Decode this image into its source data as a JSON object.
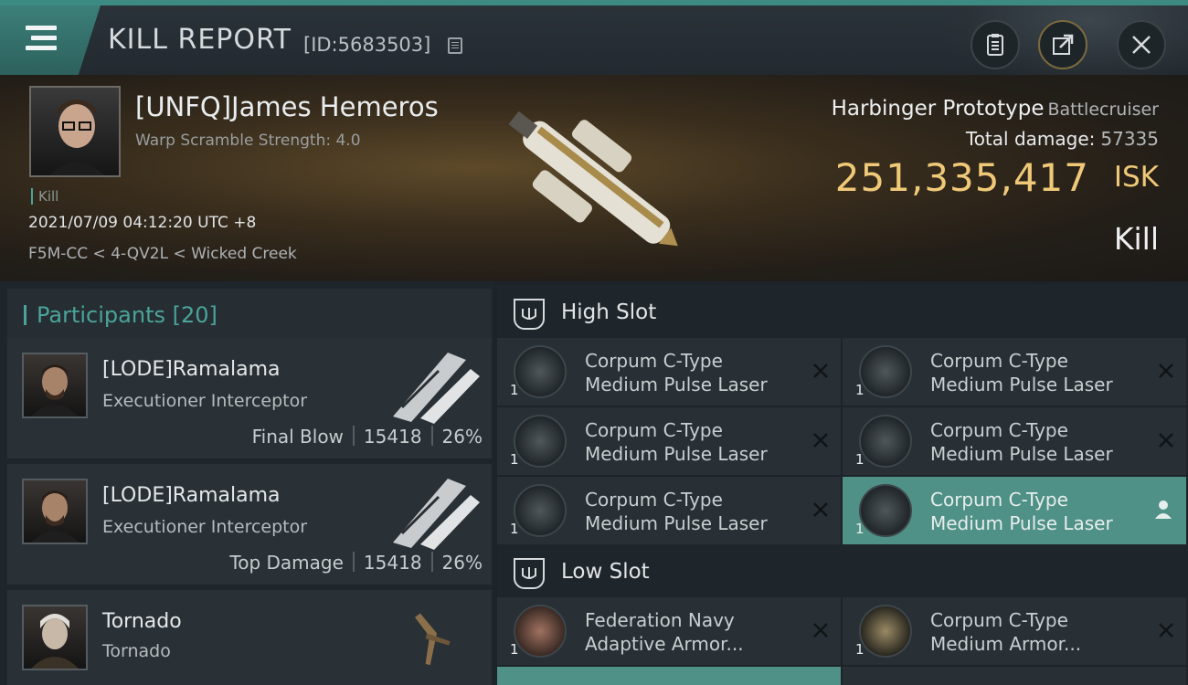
{
  "header": {
    "title": "KILL REPORT",
    "id_text": "[ID:5683503]"
  },
  "icons": {
    "menu": "hamburger-icon",
    "copy": "copy-icon",
    "clipboard": "clipboard-icon",
    "share": "share-icon",
    "close": "close-icon",
    "slot": "high-slot-icon",
    "remove": "x-icon",
    "person": "person-icon"
  },
  "victim": {
    "name": "[UNFQ]James Hemeros",
    "warp_scramble": "Warp Scramble Strength: 4.0",
    "kill_tag": "Kill",
    "timestamp": "2021/07/09 04:12:20 UTC +8",
    "location": "F5M-CC < 4-QV2L < Wicked Creek",
    "ship": "Harbinger Prototype",
    "ship_class": "Battlecruiser",
    "total_damage_label": "Total damage:",
    "total_damage": "57335",
    "isk_value": "251,335,417",
    "isk_unit": "ISK",
    "result": "Kill"
  },
  "participants": {
    "header": "Participants",
    "count": "[20]",
    "items": [
      {
        "name": "[LODE]Ramalama",
        "ship": "Executioner Interceptor",
        "tag": "Final Blow",
        "damage": "15418",
        "percent": "26%"
      },
      {
        "name": "[LODE]Ramalama",
        "ship": "Executioner Interceptor",
        "tag": "Top Damage",
        "damage": "15418",
        "percent": "26%"
      },
      {
        "name": "Tornado",
        "ship": "Tornado",
        "tag": "",
        "damage": "",
        "percent": ""
      }
    ]
  },
  "slots": {
    "high": {
      "label": "High Slot",
      "modules": [
        {
          "line1": "Corpum C-Type",
          "line2": "Medium Pulse Laser",
          "qty": "1"
        },
        {
          "line1": "Corpum C-Type",
          "line2": "Medium Pulse Laser",
          "qty": "1"
        },
        {
          "line1": "Corpum C-Type",
          "line2": "Medium Pulse Laser",
          "qty": "1"
        },
        {
          "line1": "Corpum C-Type",
          "line2": "Medium Pulse Laser",
          "qty": "1"
        },
        {
          "line1": "Corpum C-Type",
          "line2": "Medium Pulse Laser",
          "qty": "1"
        },
        {
          "line1": "Corpum C-Type",
          "line2": "Medium Pulse Laser",
          "qty": "1"
        }
      ]
    },
    "low": {
      "label": "Low Slot",
      "modules": [
        {
          "line1": "Federation Navy",
          "line2": "Adaptive Armor...",
          "qty": "1"
        },
        {
          "line1": "Corpum C-Type",
          "line2": "Medium Armor...",
          "qty": "1"
        }
      ]
    }
  },
  "colors": {
    "accent": "#4aa49a",
    "isk": "#f0c978",
    "selected": "#4f9186"
  }
}
